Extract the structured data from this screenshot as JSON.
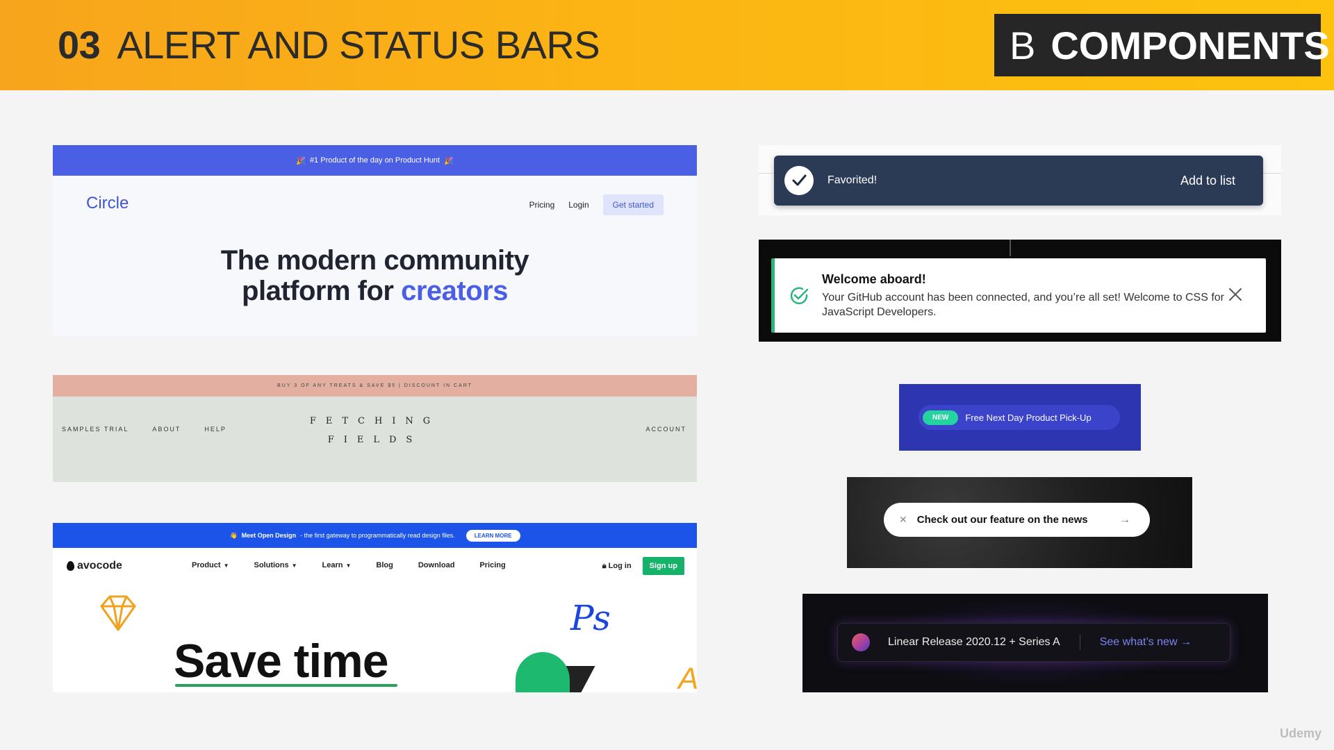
{
  "header": {
    "number": "03",
    "title": "ALERT AND STATUS BARS",
    "badge_letter": "B",
    "badge_text": "COMPONENTS"
  },
  "circle": {
    "announcement": "#1 Product of the day on Product Hunt",
    "logo": "Circle",
    "nav": [
      "Pricing",
      "Login"
    ],
    "cta": "Get started",
    "hero_line1": "The modern community",
    "hero_line2_prefix": "platform for",
    "hero_line2_accent": "creators"
  },
  "fetching": {
    "announcement": "BUY 3 OF ANY TREATS & SAVE $5 | DISCOUNT IN CART",
    "nav_left": [
      "SAMPLES TRIAL",
      "ABOUT",
      "HELP"
    ],
    "logo_line1": "FETCHING",
    "logo_line2": "FIELDS",
    "nav_right": "ACCOUNT"
  },
  "avocode": {
    "announcement_bold": "Meet Open Design",
    "announcement_rest": "- the first gateway to programmatically read design files.",
    "learn_more": "LEARN MORE",
    "logo": "avocode",
    "nav": [
      "Product",
      "Solutions",
      "Learn",
      "Blog",
      "Download",
      "Pricing"
    ],
    "login": "Log in",
    "signup": "Sign up",
    "hero": "Save time"
  },
  "favorited": {
    "message": "Favorited!",
    "action": "Add to list"
  },
  "welcome": {
    "title": "Welcome aboard!",
    "body": "Your GitHub account has been connected, and you’re all set! Welcome to CSS for JavaScript Developers."
  },
  "new_banner": {
    "tag": "NEW",
    "text": "Free Next Day Product Pick-Up"
  },
  "news": {
    "text": "Check out our feature on the news"
  },
  "linear": {
    "text": "Linear Release 2020.12 + Series A",
    "link": "See what’s new →"
  },
  "watermark": "Udemy",
  "colors": {
    "header_orange": "#fbb414",
    "circle_blue": "#4b5fe4",
    "success_green": "#29b57c",
    "avocode_blue": "#1c53e8",
    "toast_navy": "#2b3a55"
  }
}
